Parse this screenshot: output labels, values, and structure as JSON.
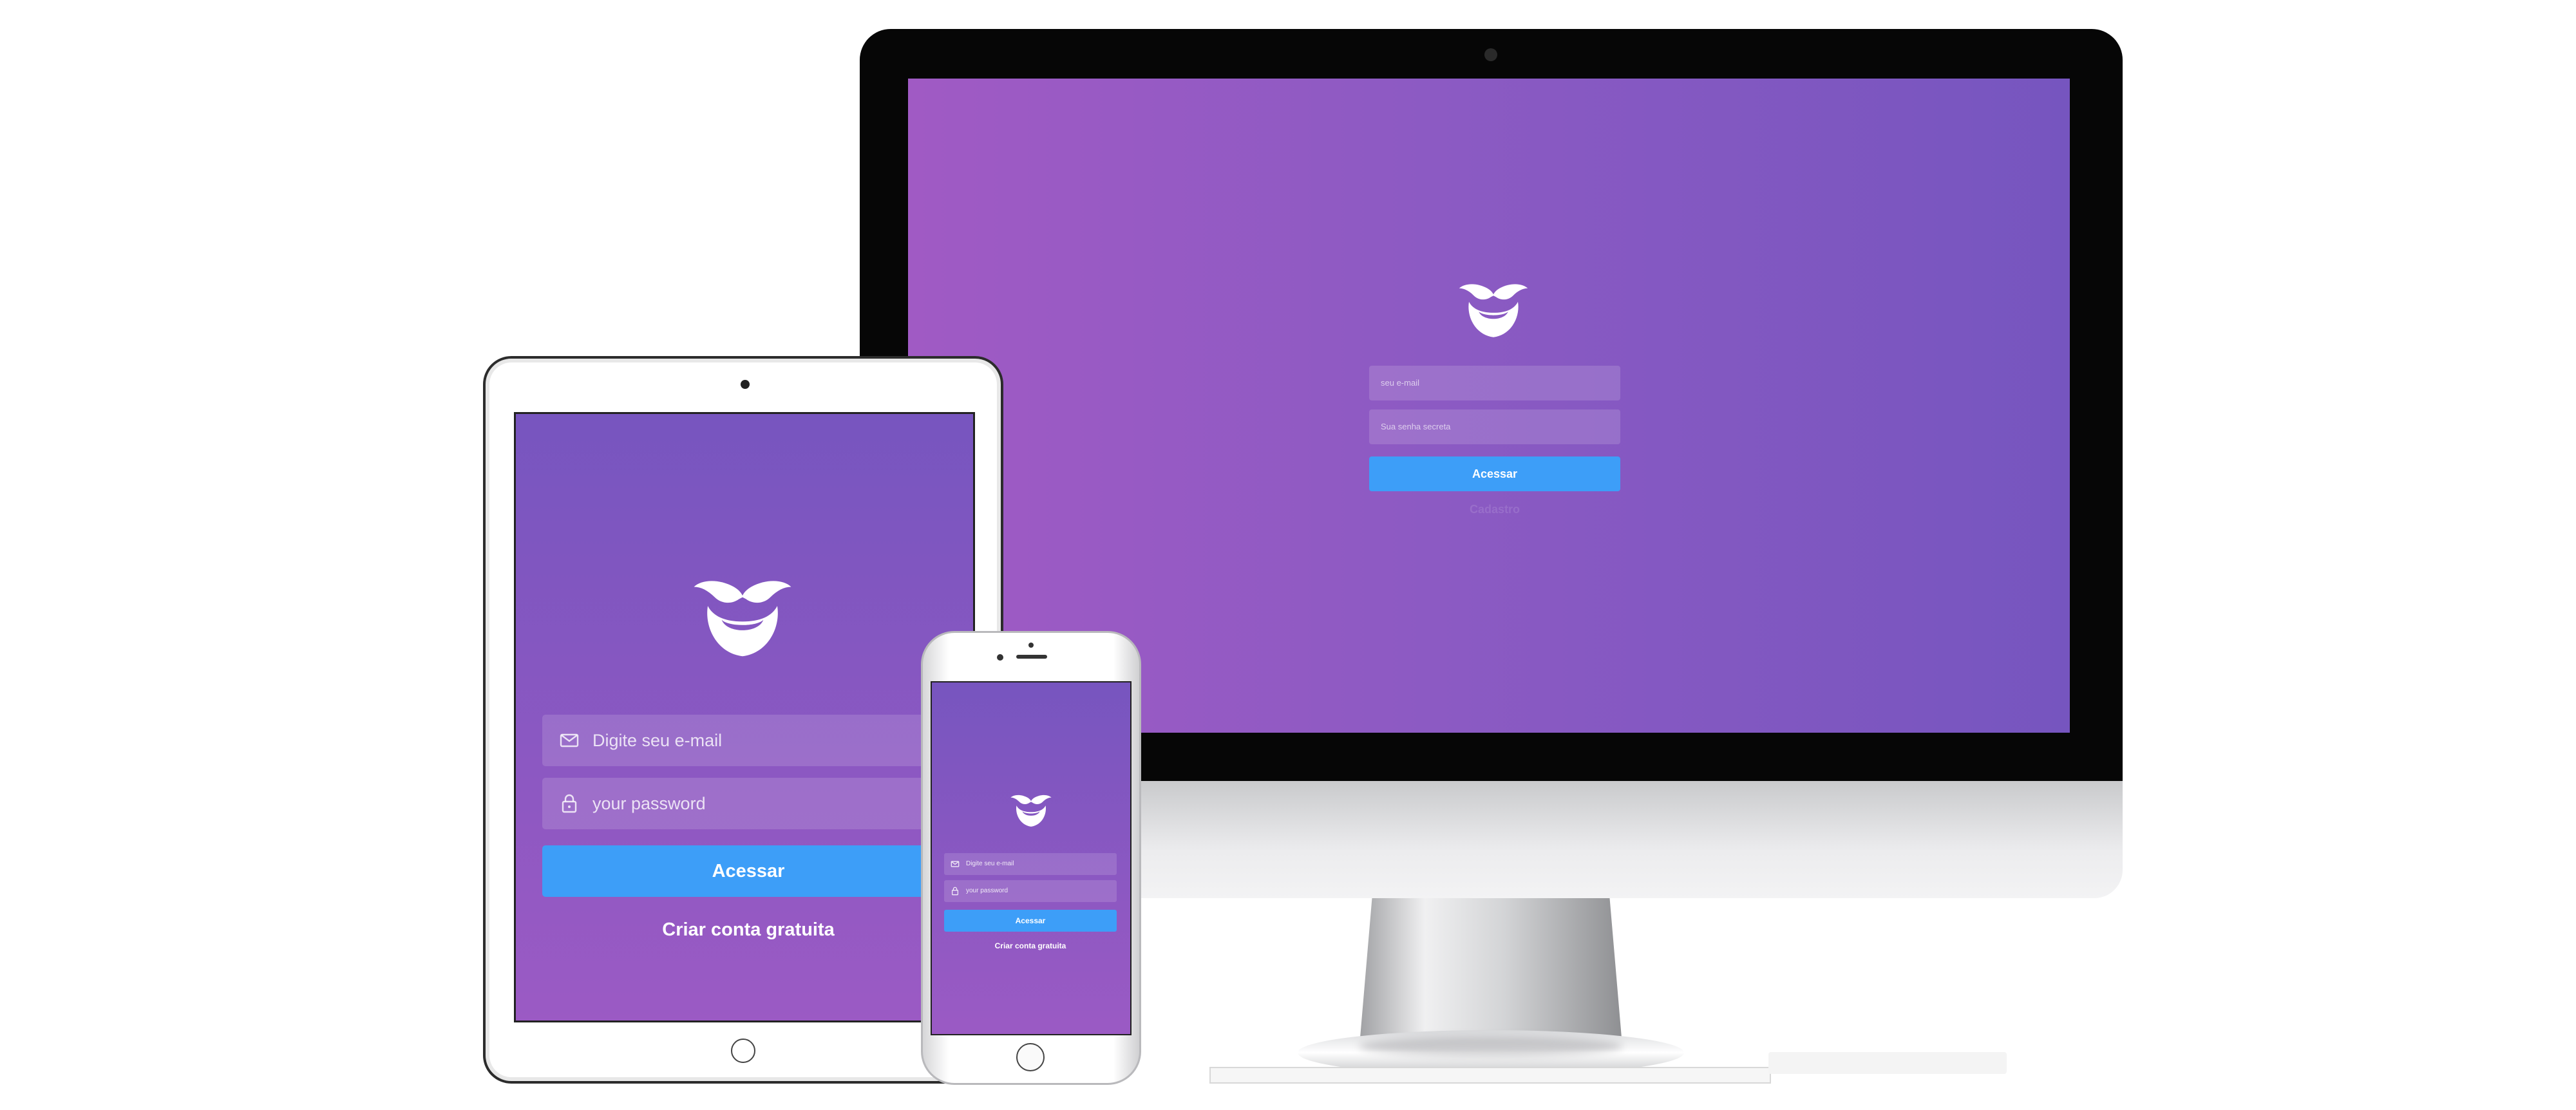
{
  "brand": {
    "accent": "#3d9ef8",
    "gradient_start": "#a05ac4",
    "gradient_end": "#7655bf",
    "logo_icon": "mustache-beard-logo"
  },
  "desktop": {
    "email_placeholder": "seu e-mail",
    "password_placeholder": "Sua senha secreta",
    "submit_label": "Acessar",
    "link_label": "Cadastro"
  },
  "tablet": {
    "email_placeholder": "Digite seu e-mail",
    "password_placeholder": "your password",
    "submit_label": "Acessar",
    "link_label": "Criar conta gratuita",
    "email_icon": "mail-icon",
    "password_icon": "lock-icon"
  },
  "phone": {
    "email_placeholder": "Digite seu e-mail",
    "password_placeholder": "your password",
    "submit_label": "Acessar",
    "link_label": "Criar conta gratuita"
  }
}
